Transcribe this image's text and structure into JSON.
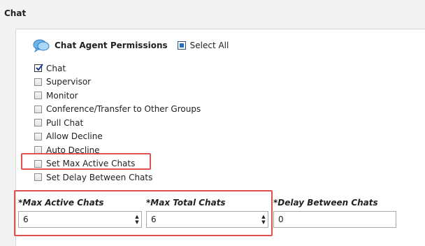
{
  "section": {
    "title": "Chat"
  },
  "permissions": {
    "header": "Chat Agent Permissions",
    "select_all": "Select All",
    "items": [
      {
        "label": "Chat",
        "checked": true
      },
      {
        "label": "Supervisor",
        "checked": false
      },
      {
        "label": "Monitor",
        "checked": false
      },
      {
        "label": "Conference/Transfer to Other Groups",
        "checked": false
      },
      {
        "label": "Pull Chat",
        "checked": false
      },
      {
        "label": "Allow Decline",
        "checked": false
      },
      {
        "label": "Auto Decline",
        "checked": false
      },
      {
        "label": "Set Max Active Chats",
        "checked": false
      },
      {
        "label": "Set Delay Between Chats",
        "checked": false
      }
    ]
  },
  "fields": {
    "max_active": {
      "label": "*Max Active Chats",
      "value": "6"
    },
    "max_total": {
      "label": "*Max Total Chats",
      "value": "6"
    },
    "delay": {
      "label": "*Delay Between Chats",
      "value": "0"
    }
  },
  "colors": {
    "highlight": "#e05252",
    "select_all_fill": "#1e6fc4"
  },
  "icons": [
    "chat-bubbles-icon",
    "checkmark-icon",
    "spinner-up-icon",
    "spinner-down-icon"
  ]
}
